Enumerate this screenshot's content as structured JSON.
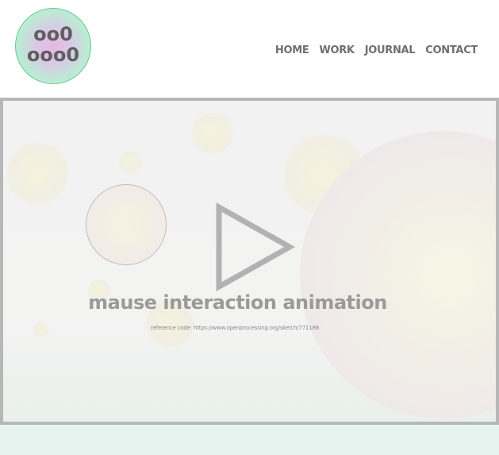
{
  "logo": {
    "line1": "oo0",
    "line2": "ooo0"
  },
  "nav": {
    "items": [
      "HOME",
      "WORK",
      "JOURNAL",
      "CONTACT"
    ]
  },
  "hero": {
    "title": "mause interaction animation",
    "reference": "reference code: https://www.openprocessing.org/sketch/771186"
  },
  "colors": {
    "accent_green": "#a9ecc8",
    "accent_pink": "#e9b7e3",
    "frame_border": "#b7b7b7",
    "footer_band": "#e5f4ef"
  },
  "icons": {
    "play": "play-triangle-icon"
  }
}
